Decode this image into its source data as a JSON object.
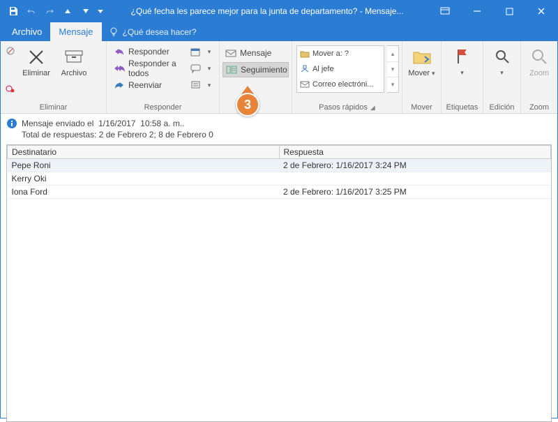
{
  "titlebar": {
    "title": "¿Qué fecha les parece mejor para la junta de departamento?  -  Mensaje..."
  },
  "tabs": {
    "archivo": "Archivo",
    "mensaje": "Mensaje",
    "tell": "¿Qué desea hacer?"
  },
  "ribbon": {
    "eliminar": {
      "label": "Eliminar",
      "eliminarBtn": "Eliminar",
      "archivoBtn": "Archivo"
    },
    "responder": {
      "label": "Responder",
      "responder": "Responder",
      "responderTodos": "Responder a todos",
      "reenviar": "Reenviar"
    },
    "seguimiento": {
      "mensajeBtn": "Mensaje",
      "seguimientoBtn": "Seguimiento"
    },
    "pasos": {
      "label": "Pasos rápidos",
      "r1": "Mover a: ?",
      "r2": "Al jefe",
      "r3": "Correo electróni..."
    },
    "mover": {
      "label": "Mover",
      "btn": "Mover"
    },
    "etiquetas": {
      "label": "Etiquetas"
    },
    "edicion": {
      "label": "Edición"
    },
    "zoom": {
      "label": "Zoom",
      "btn": "Zoom"
    }
  },
  "info": {
    "line1a": "Mensaje enviado el",
    "line1b": "1/16/2017",
    "line1c": "10:58 a. m..",
    "line2": "Total de respuestas: 2 de Febrero 2; 8 de Febrero 0"
  },
  "table": {
    "hdrDest": "Destinatario",
    "hdrResp": "Respuesta",
    "rows": [
      {
        "d": "Pepe Roni",
        "r": "2 de Febrero: 1/16/2017 3:24 PM"
      },
      {
        "d": "Kerry Oki",
        "r": ""
      },
      {
        "d": "Iona Ford",
        "r": "2 de Febrero: 1/16/2017 3:25 PM"
      }
    ]
  },
  "callout": {
    "num": "3"
  }
}
